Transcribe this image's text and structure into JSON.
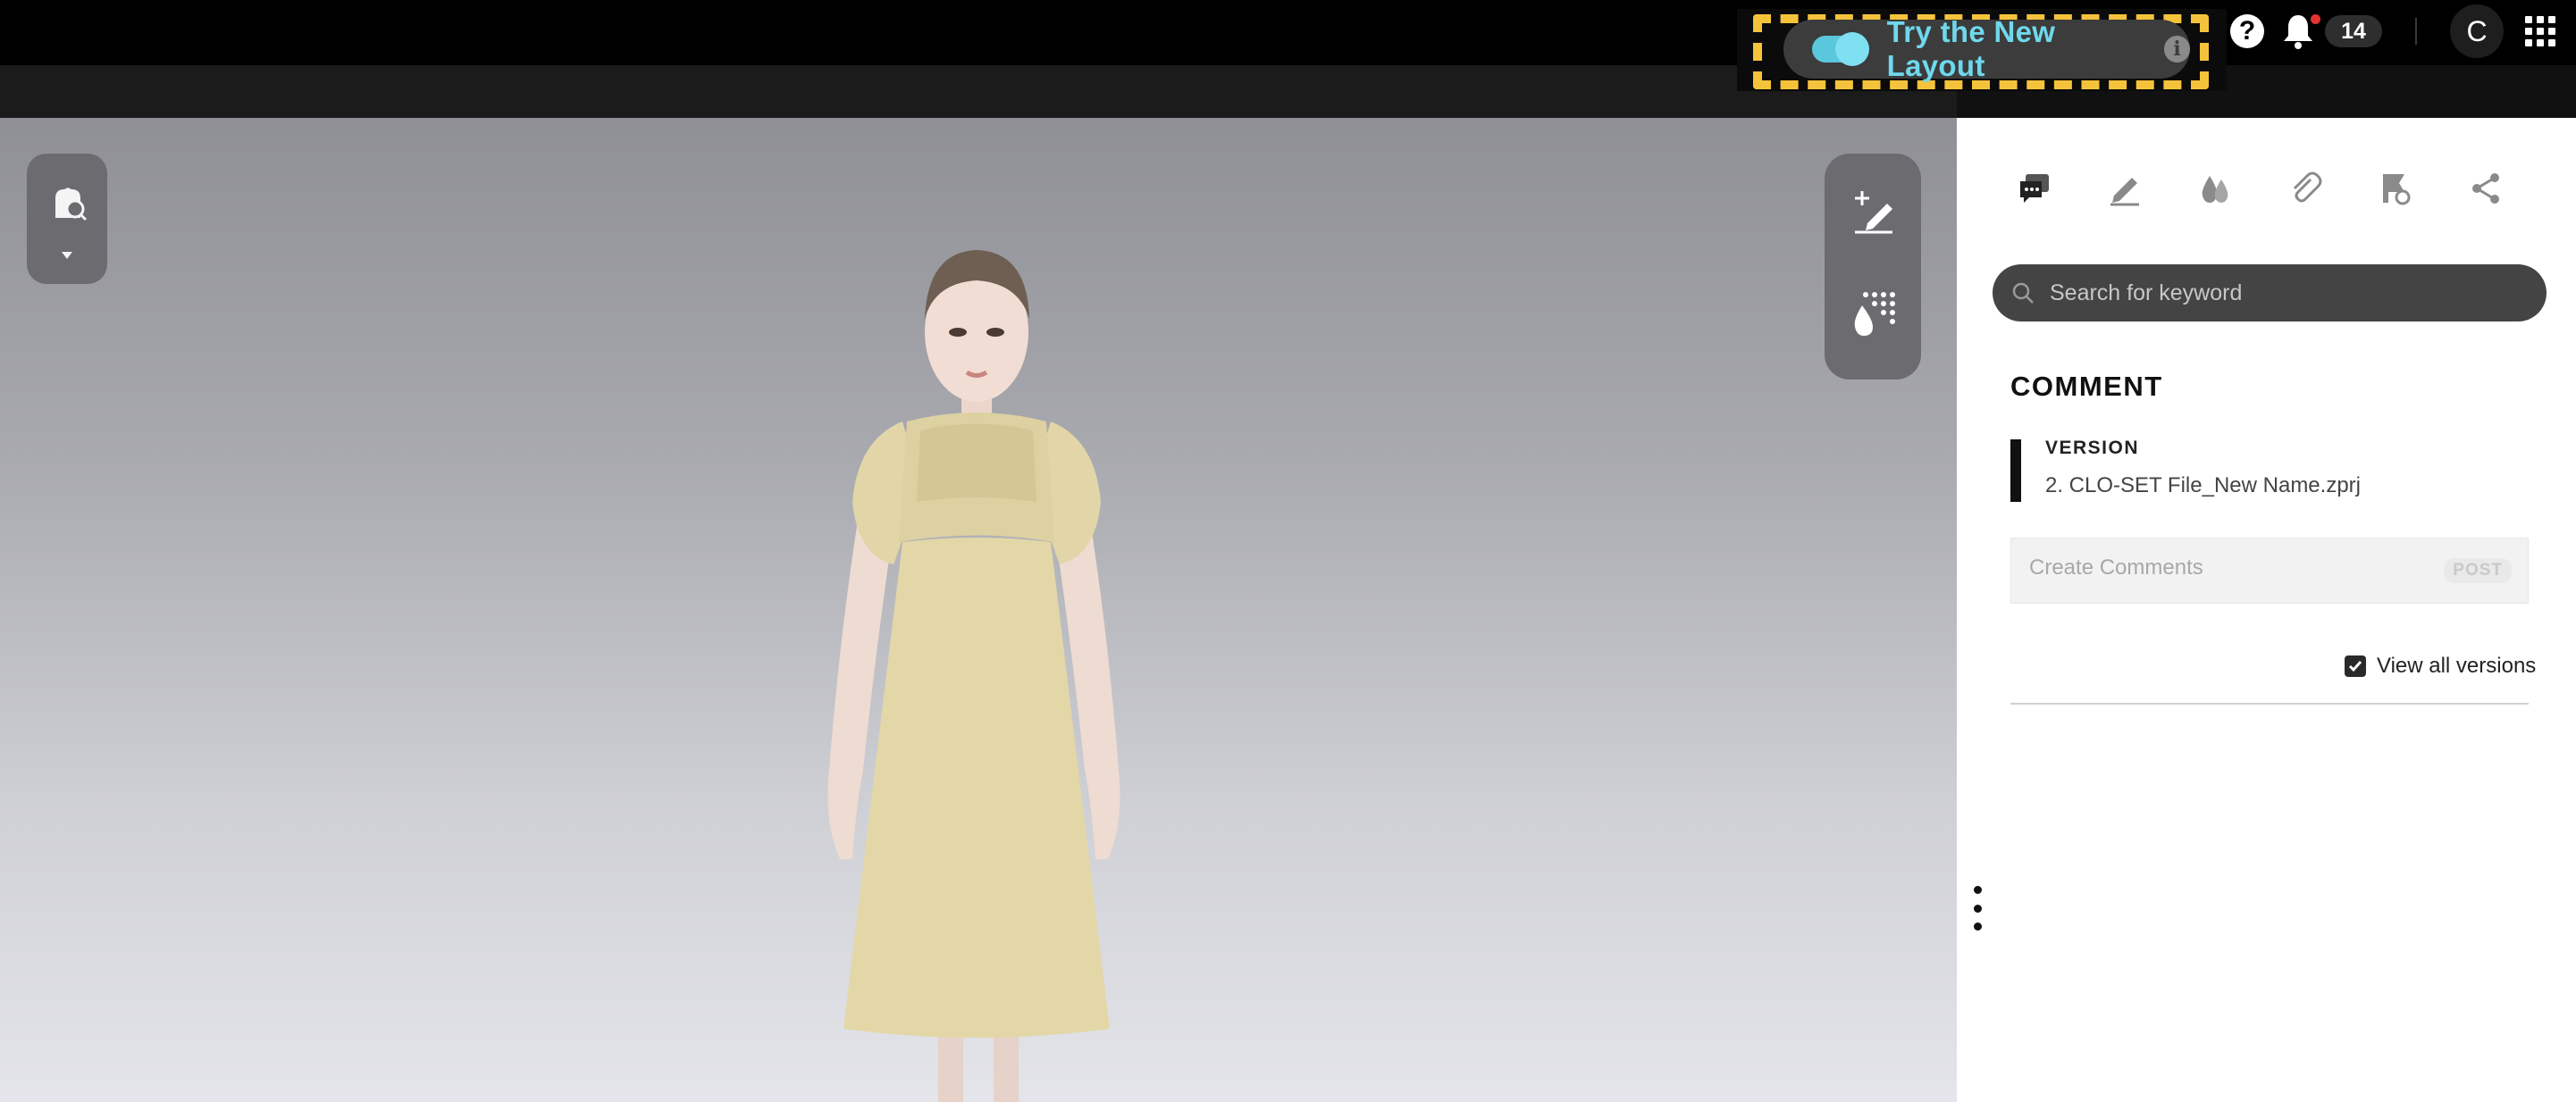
{
  "header": {
    "new_layout": {
      "label": "Try the New Layout",
      "info_icon": "info-icon",
      "toggle_icon": "toggle-icon"
    },
    "help_icon": "help-icon",
    "notifications": {
      "icon": "bell-icon",
      "count": "14"
    },
    "avatar_initial": "C",
    "apps_icon": "apps-grid-icon",
    "colors": {
      "accent_cyan": "#6fd8ec",
      "highlight_yellow": "#f5c33b",
      "badge_red": "#e23232"
    }
  },
  "viewport": {
    "left_tool": {
      "icon": "avatar-search-icon",
      "dropdown_icon": "caret-down-icon"
    },
    "right_tools": [
      {
        "icon": "add-annotation-pen-icon"
      },
      {
        "icon": "color-palette-icon"
      }
    ]
  },
  "panel": {
    "tabs": [
      {
        "icon": "comment-icon"
      },
      {
        "icon": "pencil-icon"
      },
      {
        "icon": "colorway-drops-icon"
      },
      {
        "icon": "paperclip-icon"
      },
      {
        "icon": "flag-link-icon"
      },
      {
        "icon": "share-icon"
      }
    ],
    "search": {
      "placeholder": "Search for keyword"
    },
    "comment_title": "COMMENT",
    "version": {
      "label": "VERSION",
      "file": "2. CLO-SET File_New Name.zprj"
    },
    "comment_input": {
      "placeholder": "Create Comments",
      "post_label": "POST"
    },
    "view_all": {
      "label": "View all versions",
      "checked": true
    }
  }
}
